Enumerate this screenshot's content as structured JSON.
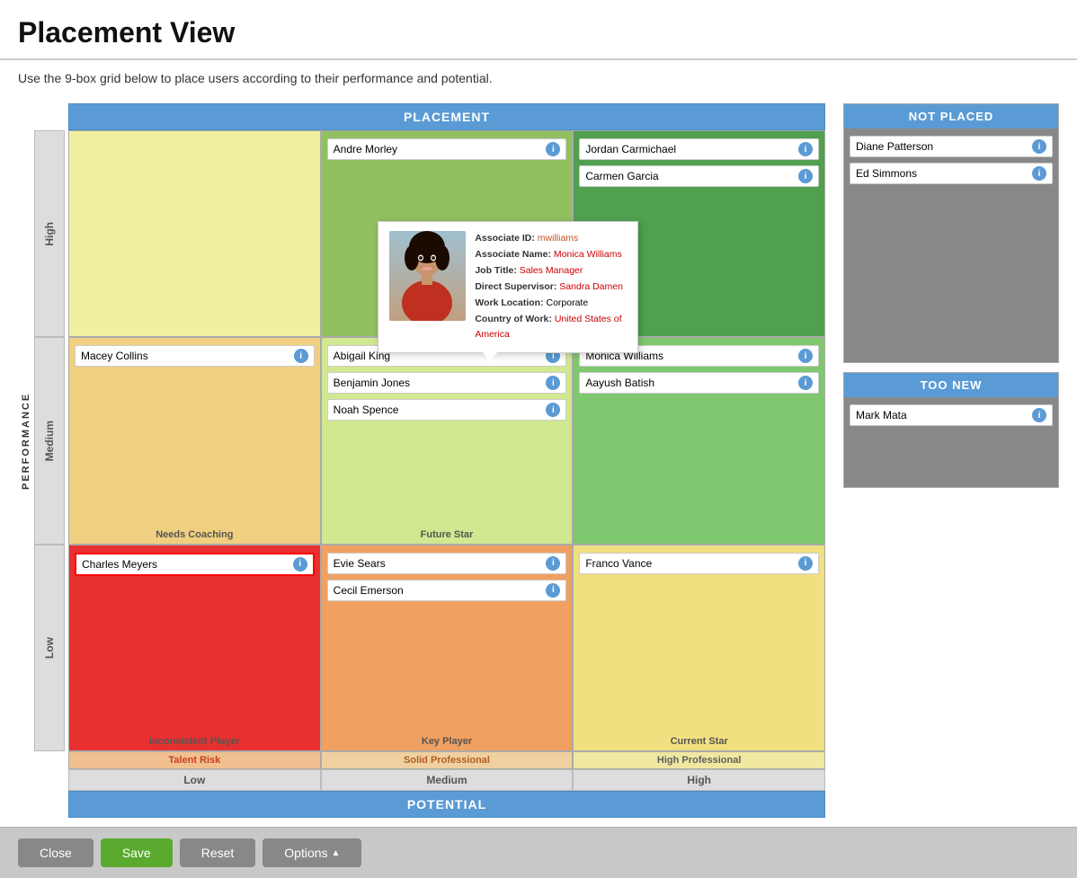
{
  "page": {
    "title": "Placement View",
    "subtitle": "Use the 9-box grid below to place users according to their performance and potential.",
    "grid_header": "PLACEMENT",
    "potential_label": "POTENTIAL",
    "performance_label": "PERFORMANCE"
  },
  "grid": {
    "rows": [
      {
        "band": "High",
        "cells": [
          {
            "type": "low",
            "category": "",
            "persons": []
          },
          {
            "type": "mid",
            "category": "",
            "persons": [
              {
                "name": "Andre Morley",
                "highlighted": false
              }
            ]
          },
          {
            "type": "high",
            "category": "",
            "persons": [
              {
                "name": "Jordan Carmichael",
                "highlighted": false
              },
              {
                "name": "Carmen Garcia",
                "highlighted": false
              }
            ]
          }
        ]
      },
      {
        "band": "Medium",
        "cells": [
          {
            "type": "low",
            "category": "Needs Coaching",
            "persons": [
              {
                "name": "Macey Collins",
                "highlighted": false
              }
            ]
          },
          {
            "type": "mid",
            "category": "Future Star",
            "persons": [
              {
                "name": "Abigail King",
                "highlighted": false
              },
              {
                "name": "Benjamin Jones",
                "highlighted": false
              },
              {
                "name": "Noah Spence",
                "highlighted": false
              }
            ]
          },
          {
            "type": "high",
            "category": "",
            "persons": [
              {
                "name": "Monica Williams",
                "highlighted": false
              },
              {
                "name": "Aayush Batish",
                "highlighted": false
              }
            ]
          }
        ]
      },
      {
        "band": "Low",
        "cells": [
          {
            "type": "low",
            "category": "Inconsistent Player",
            "persons": [
              {
                "name": "Charles Meyers",
                "highlighted": true
              }
            ]
          },
          {
            "type": "mid",
            "category": "Key Player",
            "persons": [
              {
                "name": "Evie Sears",
                "highlighted": false
              },
              {
                "name": "Cecil Emerson",
                "highlighted": false
              }
            ]
          },
          {
            "type": "high",
            "category": "Current Star",
            "persons": [
              {
                "name": "Franco Vance",
                "highlighted": false
              }
            ]
          }
        ]
      }
    ],
    "x_labels": [
      "Low",
      "Medium",
      "High"
    ],
    "row_labels_bottom": [
      "Talent Risk",
      "Solid Professional",
      "High Professional"
    ]
  },
  "not_placed": {
    "header": "NOT PLACED",
    "persons": [
      {
        "name": "Diane Patterson"
      },
      {
        "name": "Ed Simmons"
      }
    ]
  },
  "too_new": {
    "header": "TOO NEW",
    "persons": [
      {
        "name": "Mark Mata"
      }
    ]
  },
  "tooltip": {
    "associate_id_label": "Associate ID:",
    "associate_id_val": "mwilliams",
    "associate_name_label": "Associate Name:",
    "associate_name_val": "Monica Williams",
    "job_title_label": "Job Title:",
    "job_title_val": "Sales Manager",
    "supervisor_label": "Direct Supervisor:",
    "supervisor_val": "Sandra Damen",
    "work_location_label": "Work Location:",
    "work_location_val": "Corporate",
    "country_label": "Country of Work:",
    "country_val": "United States of America"
  },
  "footer": {
    "close_label": "Close",
    "save_label": "Save",
    "reset_label": "Reset",
    "options_label": "Options"
  }
}
